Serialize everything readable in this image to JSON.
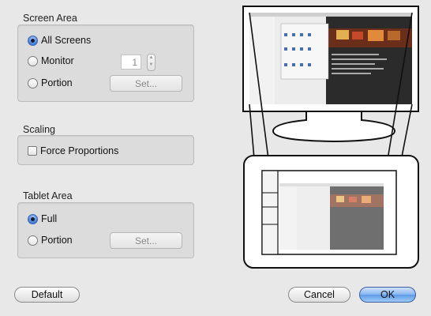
{
  "screen_area": {
    "title": "Screen Area",
    "all_screens": "All Screens",
    "monitor": "Monitor",
    "monitor_value": "1",
    "portion": "Portion",
    "set_label": "Set..."
  },
  "scaling": {
    "title": "Scaling",
    "force_proportions": "Force Proportions"
  },
  "tablet_area": {
    "title": "Tablet Area",
    "full": "Full",
    "portion": "Portion",
    "set_label": "Set..."
  },
  "buttons": {
    "default": "Default",
    "cancel": "Cancel",
    "ok": "OK"
  },
  "colors": {
    "ok_button": "#86b6f0",
    "selected_radio": "#3f78d6"
  }
}
